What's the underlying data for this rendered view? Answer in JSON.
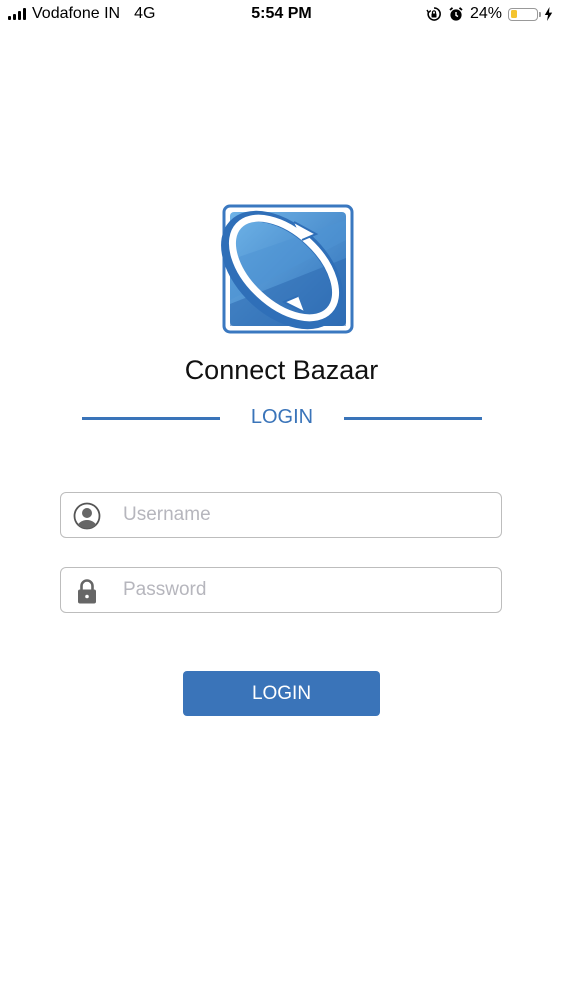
{
  "status_bar": {
    "carrier": "Vodafone IN",
    "network": "4G",
    "time": "5:54 PM",
    "battery_percent": "24%",
    "battery_level": 0.24,
    "battery_color": "#f4c430",
    "icons": [
      "signal-icon",
      "orientation-lock-icon",
      "alarm-icon",
      "battery-icon",
      "charging-icon"
    ]
  },
  "app": {
    "title": "Connect Bazaar",
    "accent_color": "#3a74b9"
  },
  "login": {
    "section_label": "LOGIN",
    "username_placeholder": "Username",
    "password_placeholder": "Password",
    "button_label": "LOGIN",
    "icons": [
      "user-icon",
      "lock-icon"
    ]
  }
}
